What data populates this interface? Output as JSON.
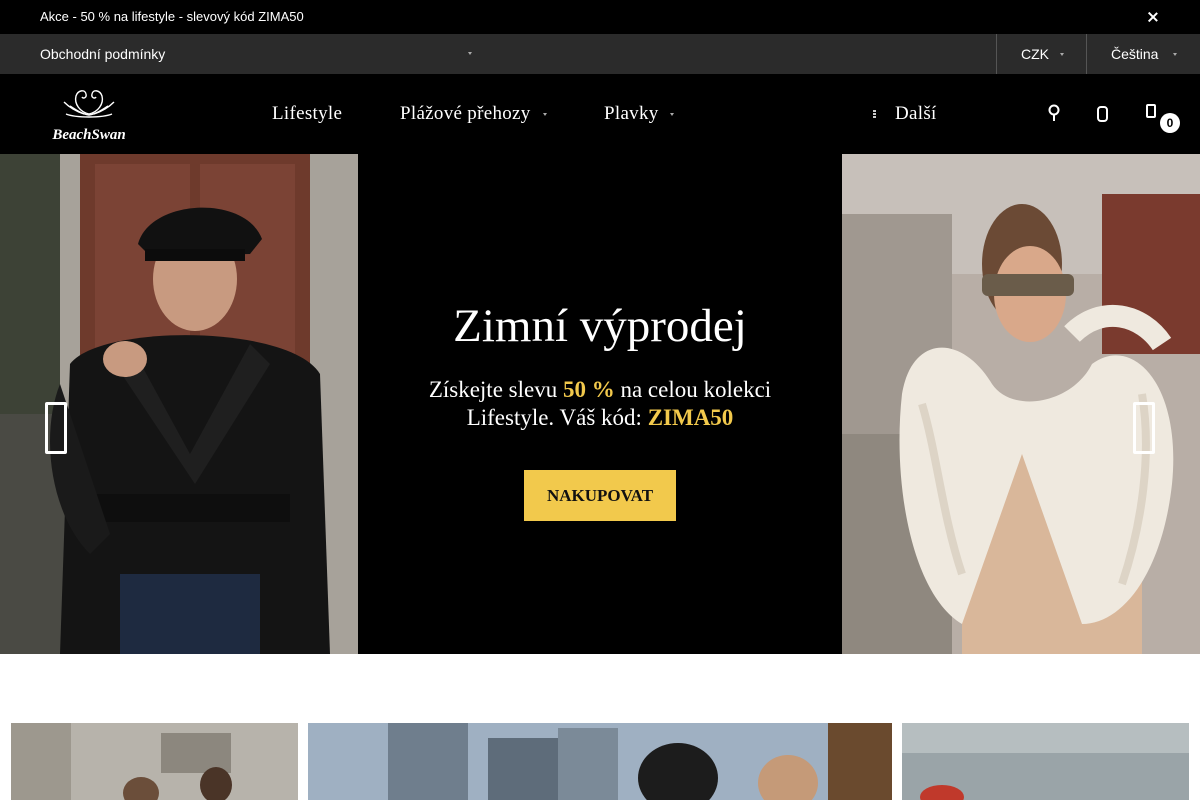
{
  "announcement": {
    "text": "Akce - 50 % na lifestyle - slevový kód ZIMA50",
    "close_icon": "close-icon"
  },
  "utility": {
    "terms_label": "Obchodní podmínky",
    "currency": "CZK",
    "language": "Čeština"
  },
  "logo": {
    "brand": "BeachSwan",
    "icon": "swan-logo"
  },
  "nav": {
    "items": [
      {
        "label": "Lifestyle",
        "has_dropdown": false
      },
      {
        "label": "Plážové přehozy",
        "has_dropdown": true
      },
      {
        "label": "Plavky",
        "has_dropdown": true
      }
    ],
    "more_label": "Další",
    "icons": [
      "search-icon",
      "user-icon",
      "cart-icon"
    ],
    "cart_count": "0"
  },
  "hero": {
    "title": "Zimní výprodej",
    "subtitle_1": "Získejte slevu ",
    "subtitle_highlight": "50 %",
    "subtitle_2": " na celou kolekci",
    "subtitle_3": "Lifestyle. Váš kód: ",
    "code": "ZIMA50",
    "cta_label": "NAKUPOVAT",
    "accent_color": "#f2c94c",
    "prev_icon": "chevron-left-icon",
    "next_icon": "chevron-right-icon"
  },
  "categories": [
    {
      "name": "category-tile-1"
    },
    {
      "name": "category-tile-2"
    },
    {
      "name": "category-tile-3"
    }
  ]
}
